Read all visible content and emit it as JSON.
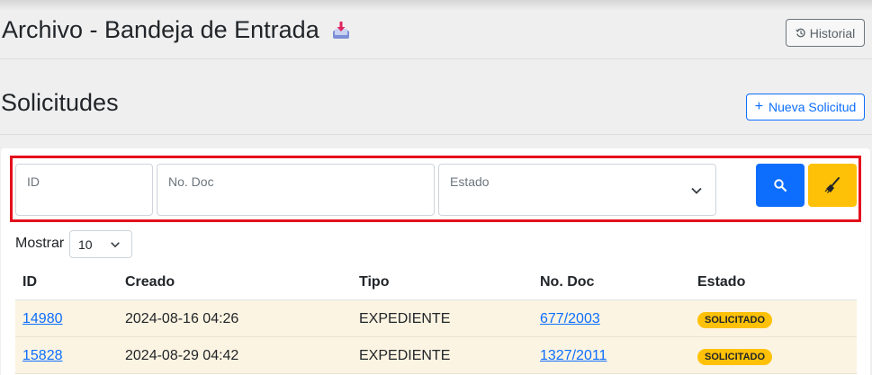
{
  "header": {
    "title": "Archivo - Bandeja de Entrada",
    "title_icon": "inbox-tray-icon",
    "history_button": "Historial",
    "history_icon": "history-icon"
  },
  "section": {
    "title": "Solicitudes",
    "new_button": "Nueva Solicitud",
    "new_icon": "plus-icon"
  },
  "filters": {
    "id_label": "ID",
    "doc_label": "No. Doc",
    "estado_label": "Estado",
    "search_icon": "search-icon",
    "clear_icon": "broom-icon",
    "accent_color": "#e3101d",
    "search_color": "#0d6efd",
    "clear_color": "#ffc107"
  },
  "paging": {
    "show_label": "Mostrar",
    "show_value": "10"
  },
  "table": {
    "columns": [
      "ID",
      "Creado",
      "Tipo",
      "No. Doc",
      "Estado"
    ],
    "rows": [
      {
        "id": "14980",
        "creado": "2024-08-16 04:26",
        "tipo": "EXPEDIENTE",
        "doc": "677/2003",
        "estado": "SOLICITADO"
      },
      {
        "id": "15828",
        "creado": "2024-08-29 04:42",
        "tipo": "EXPEDIENTE",
        "doc": "1327/2011",
        "estado": "SOLICITADO"
      }
    ],
    "row_color": "#fcf4e2",
    "badge_color": "#ffc107"
  }
}
